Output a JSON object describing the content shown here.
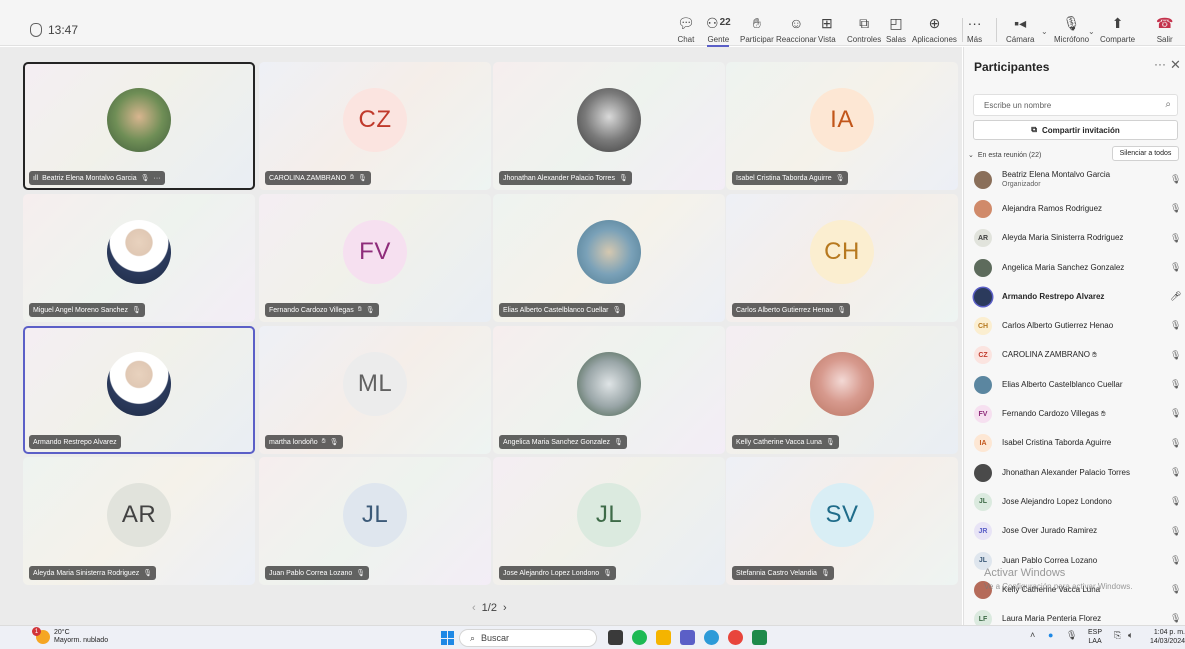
{
  "meeting": {
    "timer": "13:47"
  },
  "toolbar": {
    "items": [
      {
        "label": "Chat",
        "icon": "chat-icon"
      },
      {
        "label": "Gente",
        "icon": "people-icon",
        "count": "22"
      },
      {
        "label": "Participar",
        "icon": "raise-hand-icon"
      },
      {
        "label": "Reaccionar",
        "icon": "smiley-icon"
      },
      {
        "label": "Vista",
        "icon": "grid-view-icon"
      },
      {
        "label": "Controles",
        "icon": "controls-icon"
      },
      {
        "label": "Salas",
        "icon": "rooms-icon"
      },
      {
        "label": "Aplicaciones",
        "icon": "apps-icon"
      },
      {
        "label": "Más",
        "icon": "more-icon"
      },
      {
        "label": "Cámara",
        "icon": "camera-off-icon"
      },
      {
        "label": "Micrófono",
        "icon": "mic-off-icon"
      },
      {
        "label": "Comparte",
        "icon": "share-icon"
      },
      {
        "label": "Salir",
        "icon": "leave-phone-icon"
      }
    ],
    "active": "Gente"
  },
  "grid": {
    "tiles": [
      {
        "name": "Beatriz Elena Montalvo Garcia",
        "initials": "",
        "photo": "selfie",
        "selected": true,
        "menu": "···",
        "signal": "ıll"
      },
      {
        "name": "CAROLINA ZAMBRANO",
        "initials": "CZ",
        "initials_color": "#c0392b",
        "bg": "#fbe4e0",
        "hand": true
      },
      {
        "name": "Jhonathan Alexander Palacio Torres",
        "initials": "",
        "photo": "bw"
      },
      {
        "name": "Isabel Cristina Taborda Aguirre",
        "initials": "IA",
        "initials_color": "#c2561a",
        "bg": "#fde7d4"
      },
      {
        "name": "Miguel Angel Moreno Sanchez",
        "initials": "",
        "photo": "suit"
      },
      {
        "name": "Fernando Cardozo Villegas",
        "initials": "FV",
        "initials_color": "#8e2c7a",
        "bg": "#f6e0f0",
        "hand": true
      },
      {
        "name": "Elias Alberto Castelblanco Cuellar",
        "initials": "",
        "photo": "beach"
      },
      {
        "name": "Carlos Alberto Gutierrez Henao",
        "initials": "CH",
        "initials_color": "#b7791f",
        "bg": "#fbeed0"
      },
      {
        "name": "Armando Restrepo Alvarez",
        "initials": "",
        "photo": "suit",
        "speaking": true,
        "no_mic": true
      },
      {
        "name": "martha londoño",
        "initials": "ML",
        "initials_color": "#616161",
        "bg": "#ececec",
        "hand": true
      },
      {
        "name": "Angelica Maria Sanchez Gonzalez",
        "initials": "",
        "photo": "birds"
      },
      {
        "name": "Kelly Catherine Vacca Luna",
        "initials": "",
        "photo": "pink"
      },
      {
        "name": "Aleyda Maria Sinisterra Rodriguez",
        "initials": "AR",
        "initials_color": "#424242",
        "bg": "#e1e3dc"
      },
      {
        "name": "Juan Pablo Correa Lozano",
        "initials": "JL",
        "initials_color": "#3c5a78",
        "bg": "#dfe6ee"
      },
      {
        "name": "Jose Alejandro Lopez Londono",
        "initials": "JL",
        "initials_color": "#3e6b48",
        "bg": "#dbeadf"
      },
      {
        "name": "Stefannia Castro Velandia",
        "initials": "SV",
        "initials_color": "#1f6c8a",
        "bg": "#d9eef5"
      }
    ],
    "pager": "1/2"
  },
  "panel": {
    "title": "Participantes",
    "more": "···",
    "close": "✕",
    "search_placeholder": "Escribe un nombre",
    "invite_label": "Compartir invitación",
    "section_label": "En esta reunión (22)",
    "mute_all_label": "Silenciar a todos",
    "participants": [
      {
        "name": "Beatriz Elena Montalvo Garcia",
        "role": "Organizador",
        "initials": "",
        "bg": "#8a6f5a"
      },
      {
        "name": "Alejandra Ramos Rodriguez",
        "initials": "",
        "bg": "#d08a6a"
      },
      {
        "name": "Aleyda Maria Sinisterra Rodriguez",
        "initials": "AR",
        "bg": "#e1e3dc",
        "fg": "#424242"
      },
      {
        "name": "Angelica Maria Sanchez Gonzalez",
        "initials": "",
        "bg": "#5d6b5c"
      },
      {
        "name": "Armando Restrepo Alvarez",
        "initials": "",
        "bg": "#2b3a5c",
        "bold": true,
        "mic_on": true
      },
      {
        "name": "Carlos Alberto Gutierrez Henao",
        "initials": "CH",
        "bg": "#fbeed0",
        "fg": "#b7791f"
      },
      {
        "name": "CAROLINA ZAMBRANO",
        "initials": "CZ",
        "bg": "#fbe4e0",
        "fg": "#c0392b",
        "hand": true
      },
      {
        "name": "Elias Alberto Castelblanco Cuellar",
        "initials": "",
        "bg": "#5b86a0"
      },
      {
        "name": "Fernando Cardozo Villegas",
        "initials": "FV",
        "bg": "#f6e0f0",
        "fg": "#8e2c7a",
        "hand": true
      },
      {
        "name": "Isabel Cristina Taborda Aguirre",
        "initials": "IA",
        "bg": "#fde7d4",
        "fg": "#c2561a"
      },
      {
        "name": "Jhonathan Alexander Palacio Torres",
        "initials": "",
        "bg": "#4a4a4a"
      },
      {
        "name": "Jose Alejandro Lopez Londono",
        "initials": "JL",
        "bg": "#dbeadf",
        "fg": "#3e6b48"
      },
      {
        "name": "Jose Over Jurado Ramirez",
        "initials": "JR",
        "bg": "#e8e4f6",
        "fg": "#5b5fc7"
      },
      {
        "name": "Juan Pablo Correa Lozano",
        "initials": "JL",
        "bg": "#dfe6ee",
        "fg": "#3c5a78"
      },
      {
        "name": "Kelly Catherine Vacca Luna",
        "initials": "",
        "bg": "#b56b5a"
      },
      {
        "name": "Laura Maria Penteria Florez",
        "initials": "LF",
        "bg": "#dbeadf",
        "fg": "#3e6b48"
      }
    ],
    "watermark_title": "Activar Windows",
    "watermark_sub": "Ve a Configuración para activar Windows."
  },
  "taskbar": {
    "temperature": "20°C",
    "weather_text": "Mayorm. nublado",
    "weather_badge": "1",
    "search_label": "Buscar",
    "lang_top": "ESP",
    "lang_bottom": "LAA",
    "time": "1:04 p. m.",
    "date": "14/03/2024"
  },
  "colors": {
    "accent": "#5b5fc7",
    "leave": "#c4314b"
  }
}
